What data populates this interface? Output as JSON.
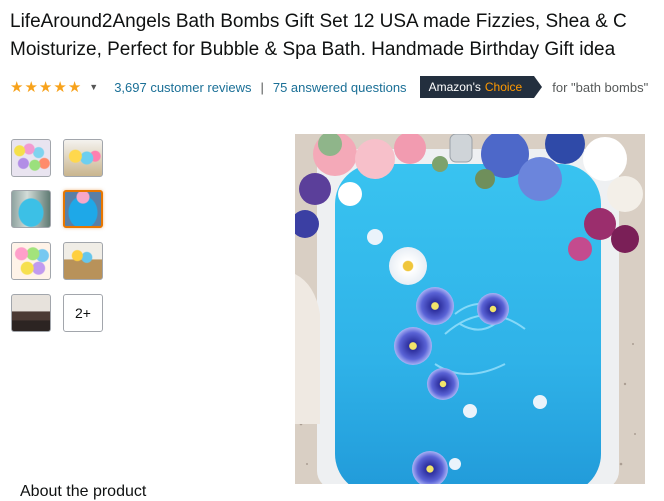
{
  "product": {
    "title_line1": "LifeAround2Angels Bath Bombs Gift Set 12 USA made Fizzies, Shea & C",
    "title_line2": "Moisturize, Perfect for Bubble & Spa Bath. Handmade Birthday Gift idea"
  },
  "rating": {
    "stars": 5,
    "reviews_text": "3,697 customer reviews",
    "separator": "|",
    "answered_text": "75 answered questions"
  },
  "badge": {
    "amazons": "Amazon's",
    "choice": "Choice",
    "for_text": "for \"bath bombs\""
  },
  "thumbnails": {
    "more_label": "2+",
    "selected_index": 3
  },
  "section": {
    "about_heading": "About the product"
  },
  "colors": {
    "star": "#f7a21b",
    "link": "#1a6f96",
    "badge_bg": "#232f3e",
    "badge_accent": "#ff9900",
    "selected_border": "#e77600",
    "water": "#2fb6ea"
  }
}
